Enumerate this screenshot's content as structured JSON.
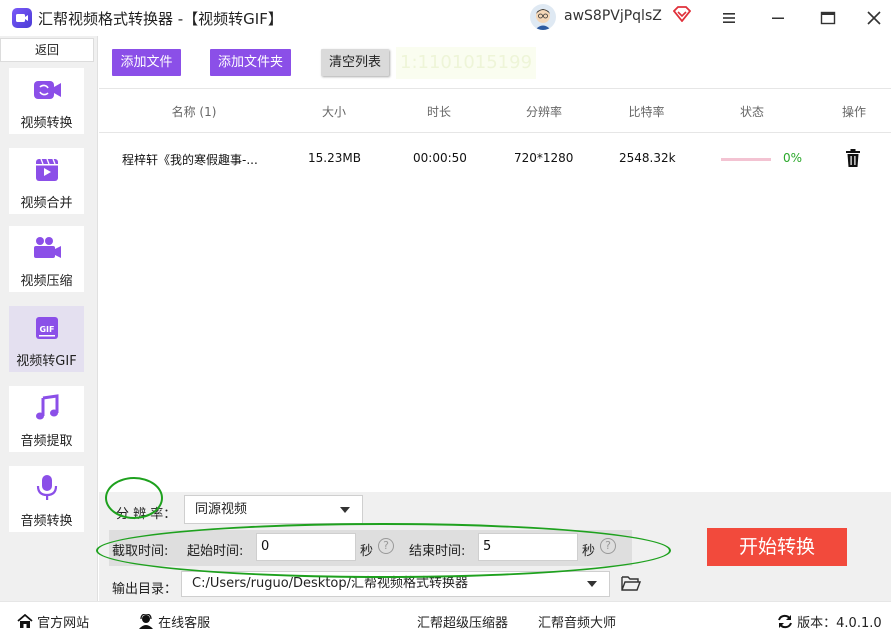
{
  "window": {
    "title": "汇帮视频格式转换器 -【视频转GIF】",
    "username": "awS8PVjPqlsZ"
  },
  "sidebar": {
    "back_label": "返回",
    "items": [
      {
        "label": "视频转换",
        "icon": "video-camera-icon"
      },
      {
        "label": "视频合并",
        "icon": "film-play-icon"
      },
      {
        "label": "视频压缩",
        "icon": "people-camera-icon"
      },
      {
        "label": "视频转GIF",
        "icon": "gif-icon"
      },
      {
        "label": "音频提取",
        "icon": "music-note-icon"
      },
      {
        "label": "音频转换",
        "icon": "microphone-icon"
      }
    ],
    "active_index": 3
  },
  "toolbar": {
    "add_file": "添加文件",
    "add_folder": "添加文件夹",
    "clear_list": "清空列表",
    "ghost_text": "1:1101015199"
  },
  "table": {
    "headers": [
      "名称 (1)",
      "大小",
      "时长",
      "分辨率",
      "比特率",
      "状态",
      "操作"
    ],
    "rows": [
      {
        "name": "程梓轩《我的寒假趣事-...",
        "size": "15.23MB",
        "duration": "00:00:50",
        "resolution": "720*1280",
        "bitrate": "2548.32k",
        "progress": "0%",
        "progress_value": 0
      }
    ]
  },
  "settings": {
    "resolution_label": "分 辨 率：",
    "resolution_value": "同源视频",
    "clip_label": "截取时间:",
    "start_label": "起始时间:",
    "start_value": "0",
    "end_label": "结束时间:",
    "end_value": "5",
    "seconds_unit": "秒",
    "help_glyph": "?",
    "output_label": "输出目录：",
    "output_path": "C:/Users/ruguo/Desktop/汇帮视频格式转换器",
    "start_button": "开始转换"
  },
  "statusbar": {
    "website": "官方网站",
    "support": "在线客服",
    "compressor": "汇帮超级压缩器",
    "audio_master": "汇帮音频大师",
    "version": "版本：4.0.1.0"
  },
  "colors": {
    "accent": "#8b4fe8",
    "start_button": "#f24a3c",
    "annotation": "#1ea11e",
    "progress": "#2aa82a"
  }
}
